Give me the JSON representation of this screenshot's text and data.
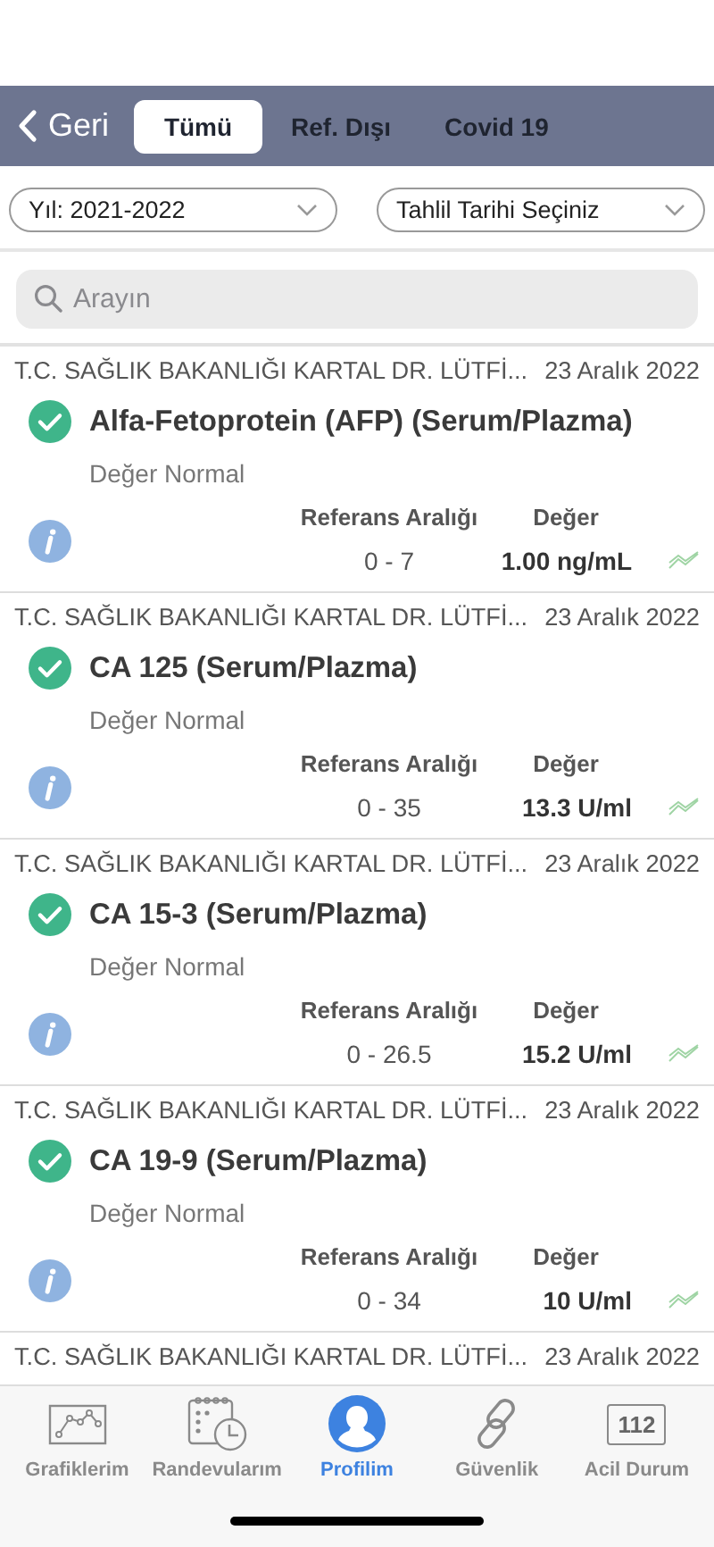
{
  "nav": {
    "back_label": "Geri",
    "tabs": [
      {
        "label": "Tümü",
        "selected": true
      },
      {
        "label": "Ref. Dışı",
        "selected": false
      },
      {
        "label": "Covid 19",
        "selected": false
      }
    ]
  },
  "filters": [
    {
      "value": "Yıl: 2021-2022"
    },
    {
      "value": "Tahlil Tarihi Seçiniz"
    }
  ],
  "search": {
    "placeholder": "Arayın"
  },
  "results": [
    {
      "source": "T.C. SAĞLIK BAKANLIĞI  KARTAL DR. LÜTFİ...",
      "date": "23 Aralık 2022",
      "normal": true,
      "test": "Alfa-Fetoprotein (AFP) (Serum/Plazma)",
      "status": "Değer Normal",
      "range_label": "Referans Aralığı",
      "value_label": "Değer",
      "range": "0 - 7",
      "value": "1.00 ng/mL"
    },
    {
      "source": "T.C. SAĞLIK BAKANLIĞI  KARTAL DR. LÜTFİ...",
      "date": "23 Aralık 2022",
      "normal": true,
      "test": "CA 125 (Serum/Plazma)",
      "status": "Değer Normal",
      "range_label": "Referans Aralığı",
      "value_label": "Değer",
      "range": "0 - 35",
      "value": "13.3 U/ml"
    },
    {
      "source": "T.C. SAĞLIK BAKANLIĞI  KARTAL DR. LÜTFİ...",
      "date": "23 Aralık 2022",
      "normal": true,
      "test": "CA 15-3 (Serum/Plazma)",
      "status": "Değer Normal",
      "range_label": "Referans Aralığı",
      "value_label": "Değer",
      "range": "0 - 26.5",
      "value": "15.2 U/ml"
    },
    {
      "source": "T.C. SAĞLIK BAKANLIĞI  KARTAL DR. LÜTFİ...",
      "date": "23 Aralık 2022",
      "normal": true,
      "test": "CA 19-9 (Serum/Plazma)",
      "status": "Değer Normal",
      "range_label": "Referans Aralığı",
      "value_label": "Değer",
      "range": "0 - 34",
      "value": "10 U/ml"
    }
  ],
  "partial_result": {
    "source": "T.C. SAĞLIK BAKANLIĞI  KARTAL DR. LÜTFİ...",
    "date": "23 Aralık 2022"
  },
  "tab_bar": [
    {
      "kind": "chart",
      "label": "Grafiklerim",
      "selected": false
    },
    {
      "kind": "calendar",
      "label": "Randevularım",
      "selected": false
    },
    {
      "kind": "profile",
      "label": "Profilim",
      "selected": true
    },
    {
      "kind": "link",
      "label": "Güvenlik",
      "selected": false
    },
    {
      "kind": "emergency",
      "label": "Acil Durum",
      "icon_text": "112",
      "selected": false
    }
  ]
}
